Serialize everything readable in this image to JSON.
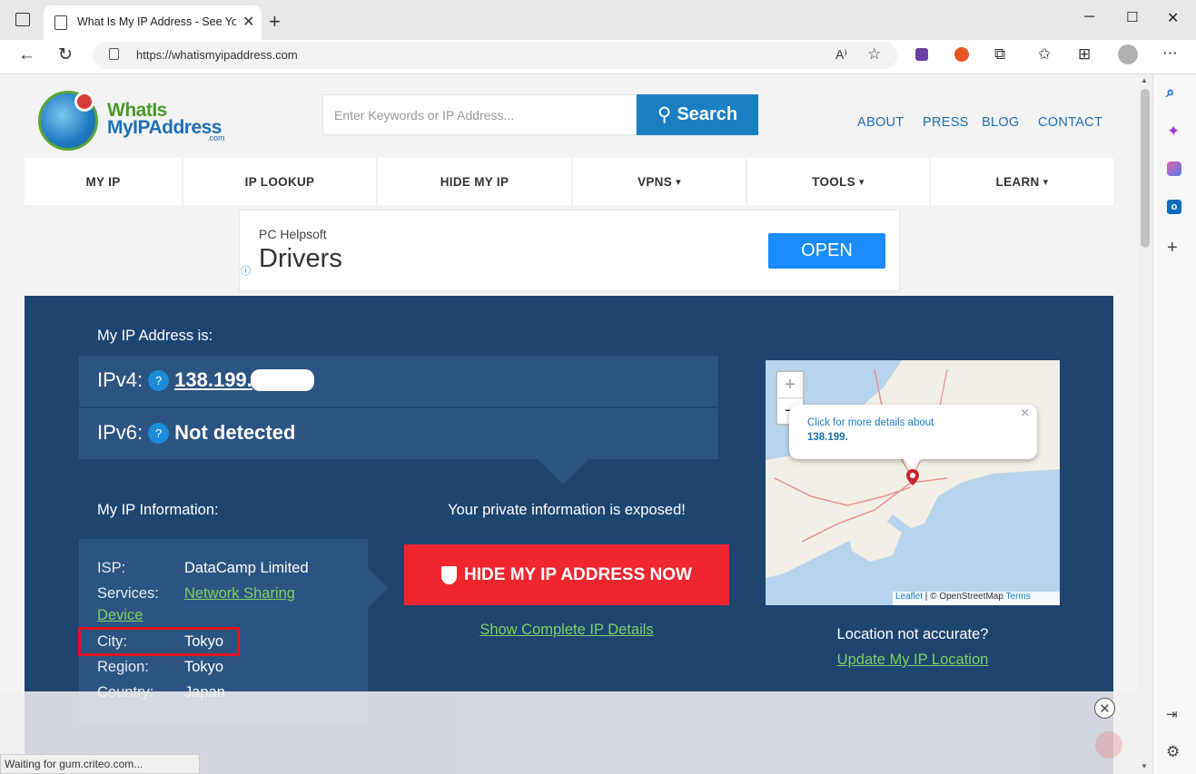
{
  "browser": {
    "tab_title": "What Is My IP Address - See Your",
    "new_tab": "+",
    "url": "https://whatismyipaddress.com",
    "window_controls": {
      "minimize": "─",
      "maximize": "☐",
      "close": "✕"
    },
    "toolbar_icons": [
      "read-aloud-icon",
      "favorite-add-icon",
      "extension-icon",
      "extension-icon",
      "extensions-icon",
      "favorites-icon",
      "collections-icon",
      "profile-icon",
      "more-icon"
    ],
    "status_text": "Waiting for gum.criteo.com..."
  },
  "site": {
    "logo": {
      "line1": "WhatIs",
      "line2": "MyIPAddress",
      "line3": ".com"
    },
    "search": {
      "placeholder": "Enter Keywords or IP Address...",
      "button": "Search"
    },
    "top_links": [
      "ABOUT",
      "PRESS",
      "BLOG",
      "CONTACT"
    ],
    "nav": [
      {
        "label": "MY IP",
        "caret": ""
      },
      {
        "label": "IP LOOKUP",
        "caret": ""
      },
      {
        "label": "HIDE MY IP",
        "caret": ""
      },
      {
        "label": "VPNS",
        "caret": "▾"
      },
      {
        "label": "TOOLS",
        "caret": "▾"
      },
      {
        "label": "LEARN",
        "caret": "▾"
      }
    ]
  },
  "ad": {
    "brand": "PC Helpsoft",
    "title": "Drivers",
    "button": "OPEN",
    "info": "ⓘ"
  },
  "hero": {
    "my_ip_label": "My IP Address is:",
    "ipv4_label": "IPv4:",
    "ipv4_value": "138.199.",
    "ipv6_label": "IPv6:",
    "ipv6_value": "Not detected",
    "help_badge": "?",
    "info_label": "My IP Information:",
    "info": {
      "isp_label": "ISP:",
      "isp_value": "DataCamp Limited",
      "services_label": "Services:",
      "services_value_line1": "Network Sharing",
      "services_value_line2": "Device",
      "city_label": "City:",
      "city_value": "Tokyo",
      "region_label": "Region:",
      "region_value": "Tokyo",
      "country_label": "Country:",
      "country_value": "Japan"
    },
    "exposed": "Your private information is exposed!",
    "hide_button": "HIDE MY IP ADDRESS NOW",
    "show_details": "Show Complete IP Details",
    "map": {
      "zoom_in": "+",
      "zoom_out": "−",
      "popup_text": "Click for more details about",
      "popup_ip": "138.199.",
      "popup_close": "×",
      "attribution_leaflet": "Leaflet",
      "attribution_sep": " | © OpenStreetMap ",
      "attribution_terms": "Terms"
    },
    "location_question": "Location not accurate?",
    "update_location": "Update My IP Location"
  },
  "overlay": {
    "close": "✕"
  }
}
